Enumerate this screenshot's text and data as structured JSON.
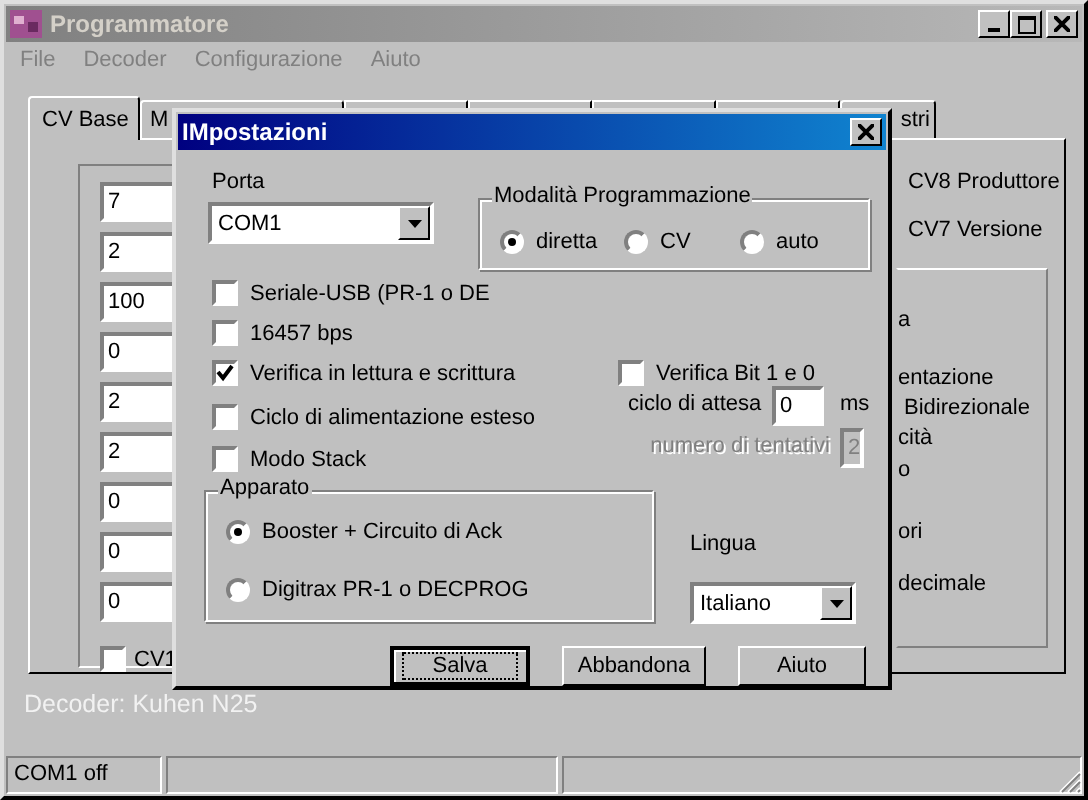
{
  "window": {
    "title": "Programmatore"
  },
  "menu": [
    "File",
    "Decoder",
    "Configurazione",
    "Aiuto"
  ],
  "tabs": [
    {
      "label": "CV Base",
      "selected": true
    },
    {
      "label": "M",
      "selected": false
    },
    {
      "label": "stri",
      "selected": false
    }
  ],
  "cv_fields": [
    "7",
    "2",
    "100",
    "0",
    "2",
    "2",
    "0",
    "0",
    "0"
  ],
  "cv_checkbox": {
    "label": "CV1",
    "checked": false
  },
  "right_labels": [
    "CV8 Produttore",
    "CV7 Versione"
  ],
  "right_group_items": [
    "a",
    "entazione",
    "Bidirezionale",
    "cità",
    "o",
    "ori",
    "decimale"
  ],
  "decoder_label": "Decoder: Kuhen N25",
  "status_bar": [
    "COM1 off"
  ],
  "dialog": {
    "title": "IMpostazioni",
    "porta": {
      "label": "Porta",
      "value": "COM1"
    },
    "mode_group": {
      "title": "Modalità Programmazione",
      "options": [
        {
          "label": "diretta",
          "selected": true
        },
        {
          "label": "CV",
          "selected": false
        },
        {
          "label": "auto",
          "selected": false
        }
      ]
    },
    "checkboxes": [
      {
        "label": "Seriale-USB (PR-1 o DE",
        "checked": false
      },
      {
        "label": "16457 bps",
        "checked": false
      },
      {
        "label": "Verifica in lettura e scrittura",
        "checked": true
      },
      {
        "label": "Ciclo di alimentazione esteso",
        "checked": false
      },
      {
        "label": "Modo Stack",
        "checked": false
      }
    ],
    "verify_bits": {
      "label": "Verifica Bit 1 e 0",
      "checked": false
    },
    "wait": {
      "label": "ciclo di attesa",
      "value": "0",
      "unit": "ms"
    },
    "retries": {
      "label": "numero di tentativi",
      "value": "2",
      "disabled": true
    },
    "apparato": {
      "title": "Apparato",
      "options": [
        {
          "label": "Booster + Circuito di Ack",
          "selected": true
        },
        {
          "label": "Digitrax PR-1 o DECPROG",
          "selected": false
        }
      ]
    },
    "lingua": {
      "label": "Lingua",
      "value": "Italiano"
    },
    "buttons": [
      {
        "label": "Salva",
        "focused": true
      },
      {
        "label": "Abbandona",
        "focused": false
      },
      {
        "label": "Aiuto",
        "focused": false
      }
    ]
  }
}
